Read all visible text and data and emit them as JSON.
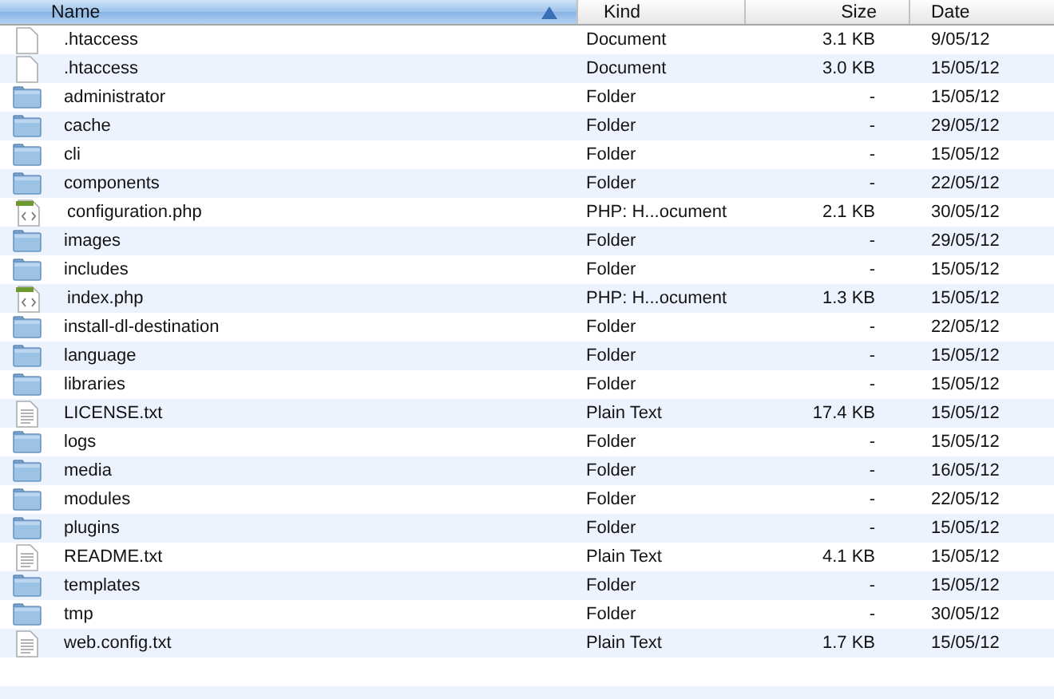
{
  "table": {
    "columns": [
      {
        "label": "Name",
        "selected": true
      },
      {
        "label": "Kind",
        "selected": false
      },
      {
        "label": "Size",
        "selected": false
      },
      {
        "label": "Date",
        "selected": false
      }
    ],
    "rows": [
      {
        "kind": "document",
        "name": ".htaccess",
        "type": "Document",
        "size": "3.1 KB",
        "date": "9/05/12"
      },
      {
        "kind": "document",
        "name": ".htaccess",
        "type": "Document",
        "size": "3.0 KB",
        "date": "15/05/12"
      },
      {
        "kind": "folder",
        "name": "administrator",
        "type": "Folder",
        "size": "-",
        "date": "15/05/12"
      },
      {
        "kind": "folder",
        "name": "cache",
        "type": "Folder",
        "size": "-",
        "date": "29/05/12"
      },
      {
        "kind": "folder",
        "name": "cli",
        "type": "Folder",
        "size": "-",
        "date": "15/05/12"
      },
      {
        "kind": "folder",
        "name": "components",
        "type": "Folder",
        "size": "-",
        "date": "22/05/12"
      },
      {
        "kind": "php",
        "name": "configuration.php",
        "type": "PHP: H...ocument",
        "size": "2.1 KB",
        "date": "30/05/12"
      },
      {
        "kind": "folder",
        "name": "images",
        "type": "Folder",
        "size": "-",
        "date": "29/05/12"
      },
      {
        "kind": "folder",
        "name": "includes",
        "type": "Folder",
        "size": "-",
        "date": "15/05/12"
      },
      {
        "kind": "php",
        "name": "index.php",
        "type": "PHP: H...ocument",
        "size": "1.3 KB",
        "date": "15/05/12"
      },
      {
        "kind": "folder",
        "name": "install-dl-destination",
        "type": "Folder",
        "size": "-",
        "date": "22/05/12"
      },
      {
        "kind": "folder",
        "name": "language",
        "type": "Folder",
        "size": "-",
        "date": "15/05/12"
      },
      {
        "kind": "folder",
        "name": "libraries",
        "type": "Folder",
        "size": "-",
        "date": "15/05/12"
      },
      {
        "kind": "text",
        "name": "LICENSE.txt",
        "type": "Plain Text",
        "size": "17.4 KB",
        "date": "15/05/12"
      },
      {
        "kind": "folder",
        "name": "logs",
        "type": "Folder",
        "size": "-",
        "date": "15/05/12"
      },
      {
        "kind": "folder",
        "name": "media",
        "type": "Folder",
        "size": "-",
        "date": "16/05/12"
      },
      {
        "kind": "folder",
        "name": "modules",
        "type": "Folder",
        "size": "-",
        "date": "22/05/12"
      },
      {
        "kind": "folder",
        "name": "plugins",
        "type": "Folder",
        "size": "-",
        "date": "15/05/12"
      },
      {
        "kind": "text",
        "name": "README.txt",
        "type": "Plain Text",
        "size": "4.1 KB",
        "date": "15/05/12"
      },
      {
        "kind": "folder",
        "name": "templates",
        "type": "Folder",
        "size": "-",
        "date": "15/05/12"
      },
      {
        "kind": "folder",
        "name": "tmp",
        "type": "Folder",
        "size": "-",
        "date": "30/05/12"
      },
      {
        "kind": "text",
        "name": "web.config.txt",
        "type": "Plain Text",
        "size": "1.7 KB",
        "date": "15/05/12"
      }
    ]
  }
}
